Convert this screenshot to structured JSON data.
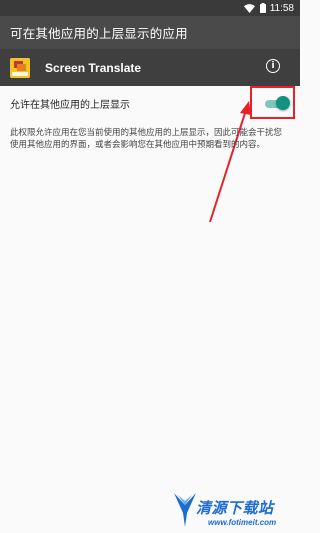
{
  "status_bar": {
    "time": "11:58",
    "icons": [
      "wifi-icon",
      "battery-icon"
    ]
  },
  "app_bar": {
    "title": "可在其他应用的上层显示的应用"
  },
  "app": {
    "name": "Screen Translate",
    "icon": "screen-translate-app-icon",
    "info_icon": "info-icon"
  },
  "setting": {
    "label": "允许在其他应用的上层显示",
    "toggle_on": true
  },
  "description": "此权限允许应用在您当前使用的其他应用的上层显示，因此可能会干扰您使用其他应用的界面，或者会影响您在其他应用中预期看到的内容。",
  "watermark": {
    "title": "清源下载站",
    "url": "www.fotimeit.com"
  },
  "colors": {
    "status_bar": "#3a3a3a",
    "app_bar": "#4a4a4a",
    "app_row": "#3f3f3f",
    "toggle_thumb": "#139181",
    "toggle_track": "#83c5bb",
    "annotation": "#e8202a",
    "watermark": "#1c6cd4"
  }
}
